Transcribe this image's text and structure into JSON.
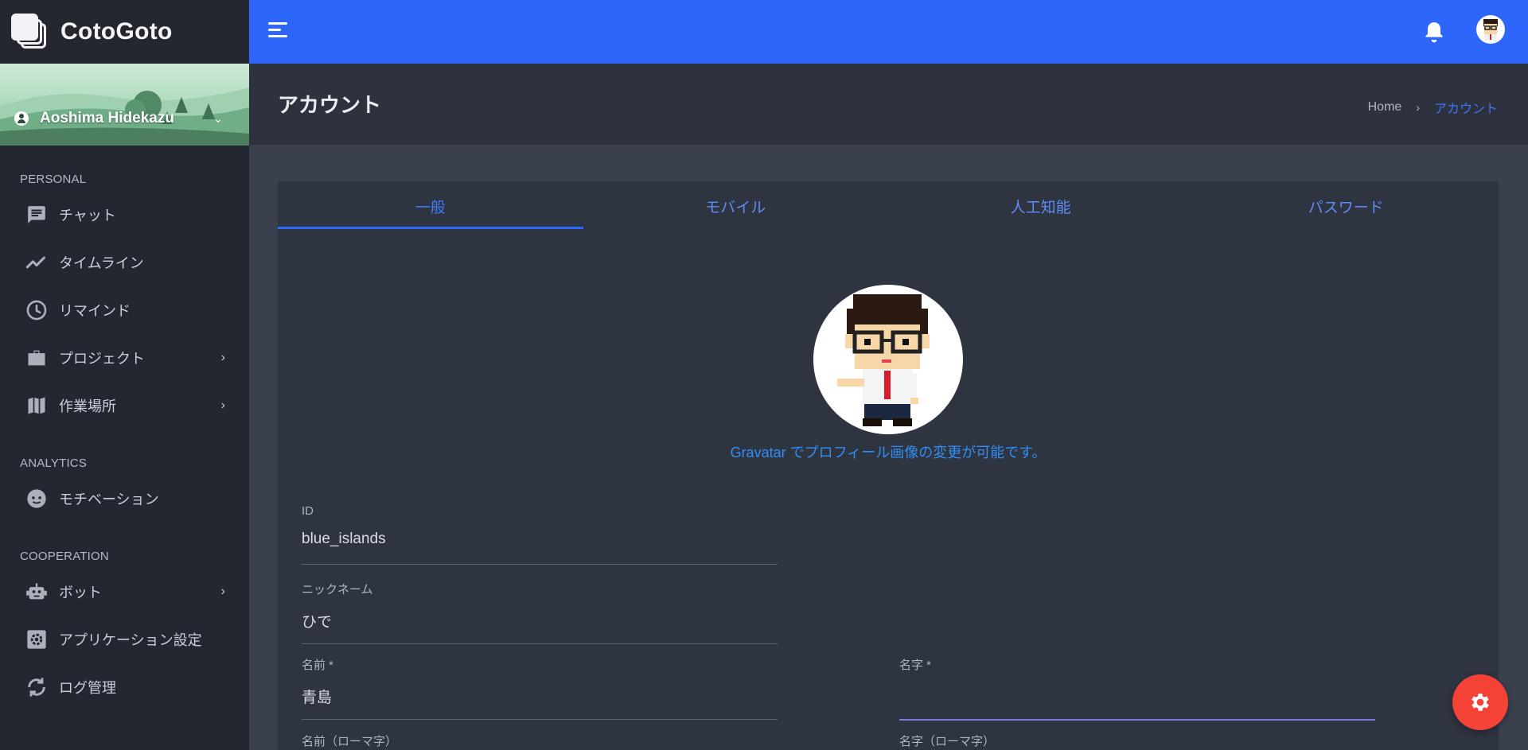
{
  "brand": {
    "name": "CotoGoto"
  },
  "user": {
    "name": "Aoshima Hidekazu"
  },
  "sidebar": {
    "sections": [
      {
        "label": "PERSONAL"
      },
      {
        "label": "ANALYTICS"
      },
      {
        "label": "COOPERATION"
      }
    ],
    "items": [
      {
        "label": "チャット",
        "icon": "chat-icon"
      },
      {
        "label": "タイムライン",
        "icon": "timeline-icon"
      },
      {
        "label": "リマインド",
        "icon": "clock-icon"
      },
      {
        "label": "プロジェクト",
        "icon": "briefcase-icon",
        "has_children": true
      },
      {
        "label": "作業場所",
        "icon": "map-icon",
        "has_children": true
      },
      {
        "label": "モチベーション",
        "icon": "face-icon"
      },
      {
        "label": "ボット",
        "icon": "robot-icon",
        "has_children": true
      },
      {
        "label": "アプリケーション設定",
        "icon": "settings-icon"
      },
      {
        "label": "ログ管理",
        "icon": "sync-icon"
      }
    ]
  },
  "header": {
    "title": "アカウント",
    "breadcrumb": {
      "home": "Home",
      "separator": "›",
      "current": "アカウント"
    }
  },
  "tabs": [
    {
      "label": "一般",
      "active": true
    },
    {
      "label": "モバイル"
    },
    {
      "label": "人工知能"
    },
    {
      "label": "パスワード"
    }
  ],
  "profile": {
    "gravatar_note": "Gravatar でプロフィール画像の変更が可能です。"
  },
  "form": {
    "id": {
      "label": "ID",
      "value": "blue_islands"
    },
    "nickname": {
      "label": "ニックネーム",
      "value": "ひで"
    },
    "first_name": {
      "label": "名前 *",
      "value": "青島"
    },
    "last_name": {
      "label": "名字 *",
      "value": ""
    },
    "first_name_roman": {
      "label": "名前（ローマ字）",
      "value": ""
    },
    "last_name_roman": {
      "label": "名字（ローマ字）",
      "value": ""
    }
  },
  "colors": {
    "accent": "#2c66fa",
    "fab": "#f44336",
    "link": "#2f8ef4"
  }
}
